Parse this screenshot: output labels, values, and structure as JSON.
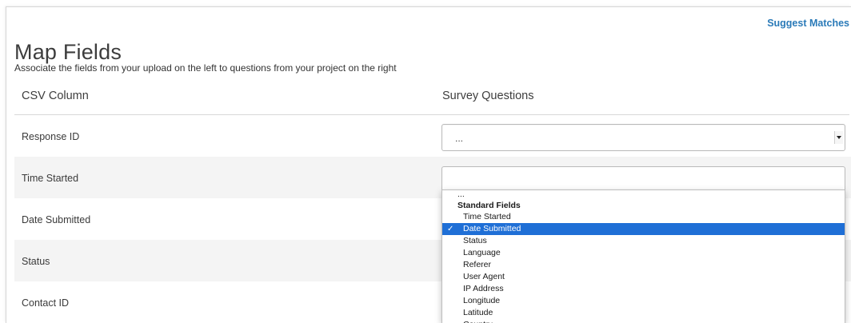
{
  "header": {
    "suggest_matches": "Suggest Matches",
    "title": "Map Fields",
    "subtitle": "Associate the fields from your upload on the left to questions from your project on the right"
  },
  "columns": {
    "csv": "CSV Column",
    "survey": "Survey Questions"
  },
  "rows": [
    {
      "label": "Response ID"
    },
    {
      "label": "Time Started"
    },
    {
      "label": "Date Submitted"
    },
    {
      "label": "Status"
    },
    {
      "label": "Contact ID"
    }
  ],
  "select_response_id": {
    "value": "..."
  },
  "dropdown": {
    "empty_option": "...",
    "group_label": "Standard Fields",
    "selected_index": 1,
    "check": "✓",
    "options": [
      "Time Started",
      "Date Submitted",
      "Status",
      "Language",
      "Referer",
      "User Agent",
      "IP Address",
      "Longitude",
      "Latitude",
      "Country"
    ]
  },
  "colors": {
    "link": "#2a7ab8",
    "selected_bg": "#1f6fd6",
    "row_alt": "#f4f4f4"
  }
}
